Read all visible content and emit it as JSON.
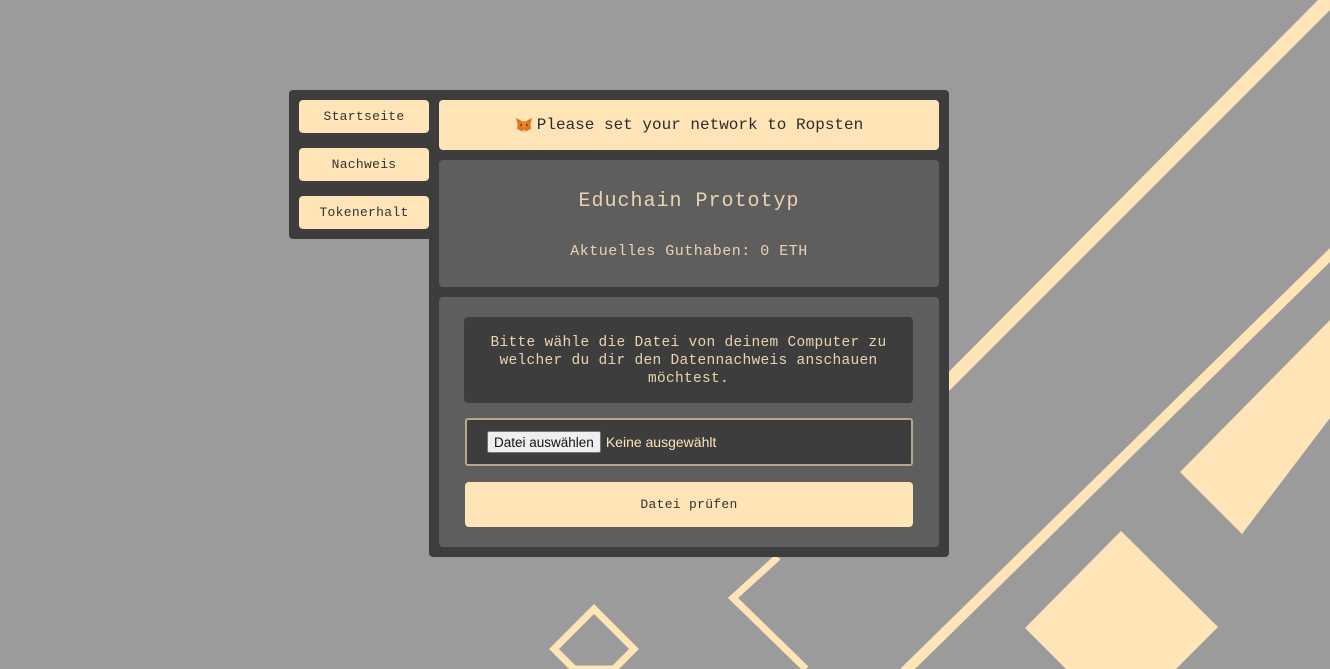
{
  "nav": {
    "items": [
      {
        "label": "Startseite"
      },
      {
        "label": "Nachweis"
      },
      {
        "label": "Tokenerhalt"
      }
    ]
  },
  "network_banner": {
    "icon": "metamask-fox-icon",
    "text": "Please set your network to Ropsten"
  },
  "header": {
    "title": "Educhain Prototyp",
    "balance": "Aktuelles Guthaben: 0 ETH"
  },
  "verify": {
    "instruction": "Bitte wähle die Datei von deinem Computer zu welcher du dir den Datennachweis anschauen möchtest.",
    "file_button_label": "Datei auswählen",
    "file_status": "Keine ausgewählt",
    "submit_label": "Datei prüfen"
  },
  "colors": {
    "background": "#9b9b9b",
    "panel": "#3d3d3d",
    "card": "#5e5e5e",
    "accent": "#ffe4b8",
    "text_light": "#ebd3b0"
  }
}
